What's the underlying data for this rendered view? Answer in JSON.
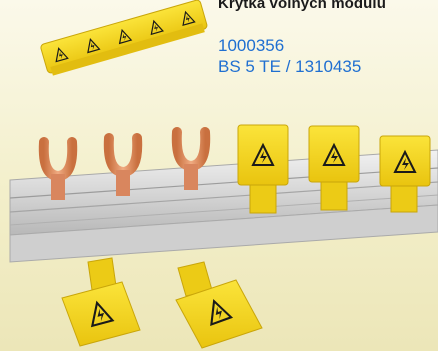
{
  "product": {
    "title": "Krytka volných modulů",
    "code": "1000356",
    "type": "BS 5 TE / 1310435"
  },
  "colors": {
    "accent_text": "#1f6fd1",
    "cap_yellow": "#f4d21c",
    "copper": "#d9865e",
    "busbar": "#d9d9d9"
  },
  "icons": [
    "high-voltage-warning-icon"
  ]
}
